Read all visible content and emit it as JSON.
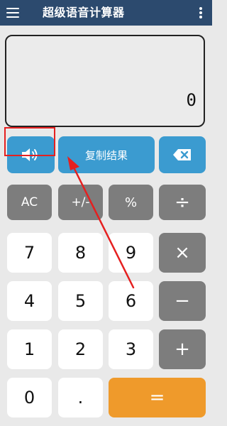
{
  "app": {
    "title": "超级语音计算器"
  },
  "display": {
    "value": "0"
  },
  "actions": {
    "copy_result_label": "复制结果"
  },
  "keys": {
    "ac": "AC",
    "plus_minus": "+/-",
    "percent": "%",
    "divide": "÷",
    "multiply": "×",
    "minus": "−",
    "plus": "+",
    "equals": "=",
    "seven": "7",
    "eight": "8",
    "nine": "9",
    "four": "4",
    "five": "5",
    "six": "6",
    "one": "1",
    "two": "2",
    "three": "3",
    "zero": "0",
    "dot": "."
  },
  "colors": {
    "appbar": "#2c4a6e",
    "blue": "#3b9bd0",
    "gray": "#7d7d7d",
    "orange": "#ef9a2b",
    "annotation": "#e52020"
  },
  "icons": {
    "menu": "menu-icon",
    "more": "more-vertical-icon",
    "speaker": "speaker-icon",
    "backspace": "backspace-icon"
  }
}
